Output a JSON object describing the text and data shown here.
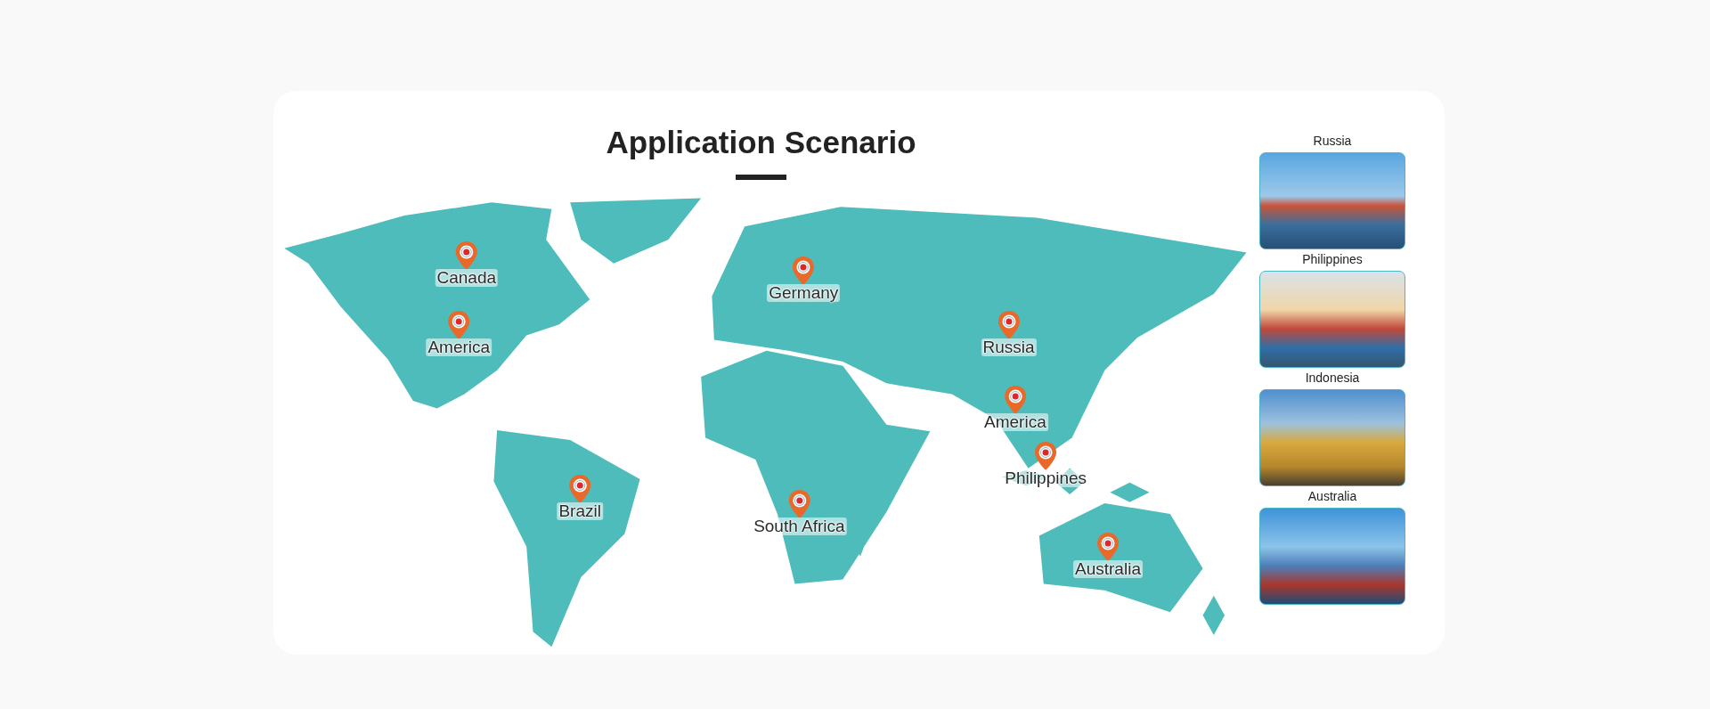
{
  "title": "Application Scenario",
  "map": {
    "pins": [
      {
        "label": "Canada"
      },
      {
        "label": "America"
      },
      {
        "label": "Germany"
      },
      {
        "label": "Russia"
      },
      {
        "label": "America"
      },
      {
        "label": "Philippines"
      },
      {
        "label": "Brazil"
      },
      {
        "label": "South Africa"
      },
      {
        "label": "Australia"
      }
    ]
  },
  "gallery": [
    {
      "caption": "Russia"
    },
    {
      "caption": "Philippines"
    },
    {
      "caption": "Indonesia"
    },
    {
      "caption": "Australia"
    }
  ]
}
